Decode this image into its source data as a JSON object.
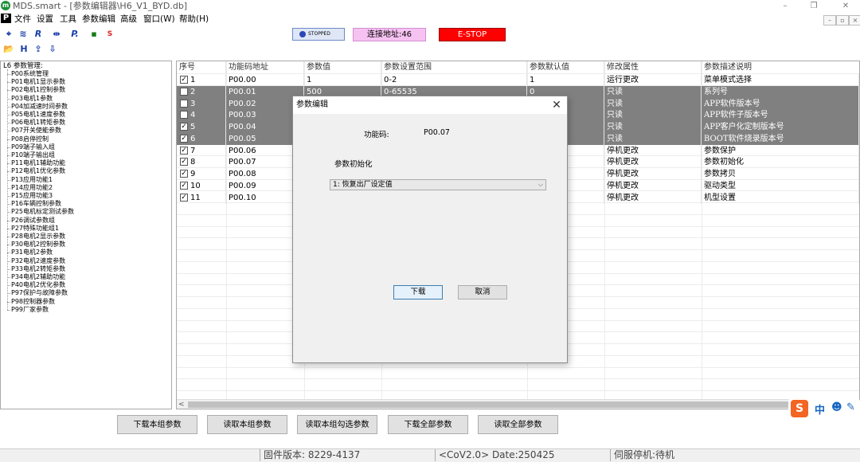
{
  "window": {
    "title": "MDS.smart - [参数编辑器\\H6_V1_BYD.db]",
    "app_logo": "m",
    "minimize": "–",
    "restore": "❐",
    "close": "✕"
  },
  "menu": {
    "logo": "P",
    "items": [
      "文件",
      "设置",
      "工具",
      "参数编辑",
      "高级",
      "窗口(W)",
      "帮助(H)"
    ],
    "mdi_buttons": [
      "–",
      "▫",
      "×"
    ]
  },
  "toolbar": {
    "row1_icons": [
      "⌖",
      "≋",
      "R",
      "⇹",
      "P.",
      "▪",
      "S"
    ],
    "row2_icons": [
      "📂",
      "H",
      "⇪",
      "⇩"
    ],
    "status_label": "STOPPED",
    "connection": "连接地址:46",
    "estop": "E-STOP"
  },
  "tree": {
    "root": "L6 参数管理:",
    "items": [
      "P00系统管理",
      "P01电机1显示参数",
      "P02电机1控制参数",
      "P03电机1参数",
      "P04加减速时间参数",
      "P05电机1速度参数",
      "P06电机1转矩参数",
      "P07开关使能参数",
      "P08启停控制",
      "P09端子输入组",
      "P10端子输出组",
      "P11电机1辅助功能",
      "P12电机1优化参数",
      "P13应用功能1",
      "P14应用功能2",
      "P15应用功能3",
      "P16车辆控制参数",
      "P25电机标定测试参数",
      "P26调试参数组",
      "P27特殊功能组1",
      "P28电机2显示参数",
      "P30电机2控制参数",
      "P31电机2参数",
      "P32电机2速度参数",
      "P33电机2转矩参数",
      "P34电机2辅助功能",
      "P40电机2优化参数",
      "P97保护与故障参数",
      "P98控制器参数",
      "P99厂家参数"
    ]
  },
  "grid": {
    "headers": [
      "序号",
      "功能码地址",
      "参数值",
      "参数设置范围",
      "参数默认值",
      "修改属性",
      "参数描述说明"
    ],
    "rows": [
      {
        "checked": true,
        "selected": false,
        "no": "1",
        "addr": "P00.00",
        "value": "1",
        "range": "0-2",
        "default": "1",
        "attr": "运行更改",
        "desc": "菜单模式选择"
      },
      {
        "checked": false,
        "selected": true,
        "no": "2",
        "addr": "P00.01",
        "value": "500",
        "range": "0-65535",
        "default": "0",
        "attr": "只读",
        "desc": "系列号"
      },
      {
        "checked": false,
        "selected": true,
        "no": "3",
        "addr": "P00.02",
        "value": "",
        "range": "",
        "default": "",
        "attr": "只读",
        "desc": "APP软件版本号"
      },
      {
        "checked": false,
        "selected": true,
        "no": "4",
        "addr": "P00.03",
        "value": "",
        "range": "",
        "default": "",
        "attr": "只读",
        "desc": "APP软件子版本号"
      },
      {
        "checked": true,
        "selected": true,
        "no": "5",
        "addr": "P00.04",
        "value": "",
        "range": "",
        "default": "",
        "attr": "只读",
        "desc": "APP客户化定制版本号"
      },
      {
        "checked": true,
        "selected": true,
        "no": "6",
        "addr": "P00.05",
        "value": "",
        "range": "",
        "default": "",
        "attr": "只读",
        "desc": "BOOT软件烧录版本号"
      },
      {
        "checked": true,
        "selected": false,
        "no": "7",
        "addr": "P00.06",
        "value": "",
        "range": "",
        "default": "",
        "attr": "停机更改",
        "desc": "参数保护"
      },
      {
        "checked": true,
        "selected": false,
        "no": "8",
        "addr": "P00.07",
        "value": "",
        "range": "",
        "default": "",
        "attr": "停机更改",
        "desc": "参数初始化"
      },
      {
        "checked": true,
        "selected": false,
        "no": "9",
        "addr": "P00.08",
        "value": "",
        "range": "",
        "default": "",
        "attr": "停机更改",
        "desc": "参数拷贝"
      },
      {
        "checked": true,
        "selected": false,
        "no": "10",
        "addr": "P00.09",
        "value": "",
        "range": "",
        "default": "",
        "attr": "停机更改",
        "desc": "驱动类型"
      },
      {
        "checked": true,
        "selected": false,
        "no": "11",
        "addr": "P00.10",
        "value": "",
        "range": "",
        "default": "",
        "attr": "停机更改",
        "desc": "机型设置"
      }
    ],
    "scroll_left": "<"
  },
  "buttons": [
    "下载本组参数",
    "读取本组参数",
    "读取本组勾选参数",
    "下载全部参数",
    "读取全部参数"
  ],
  "statusbar": {
    "firmware": "固件版本: 8229-4137",
    "cov": "<CoV2.0> Date:250425",
    "servo": "伺服停机:待机"
  },
  "dialog": {
    "title": "参数编辑",
    "close": "✕",
    "code_label": "功能码:",
    "code_value": "P00.07",
    "param_label": "参数初始化",
    "select_value": "1: 恢复出厂设定值",
    "ok": "下载",
    "cancel": "取消"
  },
  "ime": {
    "logo": "S",
    "lang": "中"
  },
  "colors": {
    "selected_row": "#808080",
    "estop": "#ff0000",
    "connection": "#f6c2f2",
    "stopped_badge": "#dfe7f6"
  }
}
